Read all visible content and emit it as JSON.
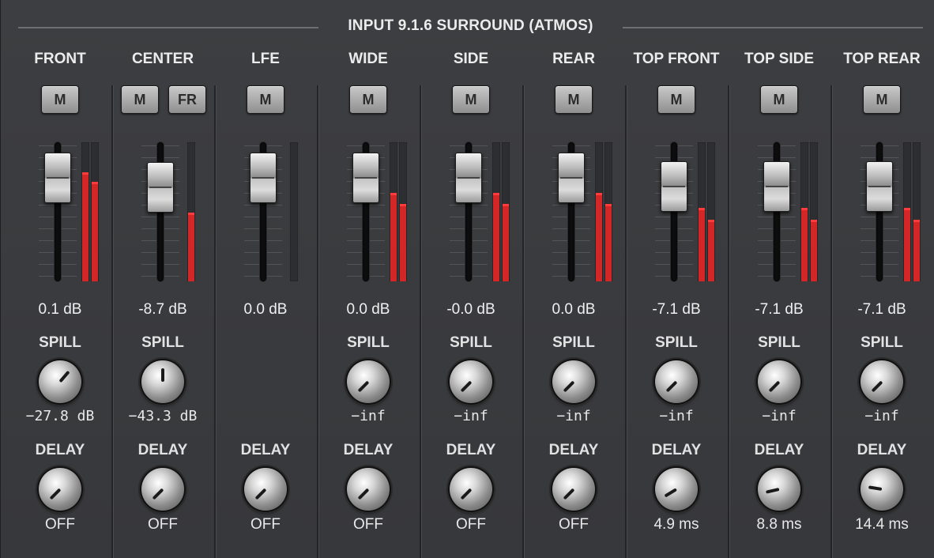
{
  "title": "INPUT 9.1.6 SURROUND (ATMOS)",
  "labels": {
    "spill": "SPILL",
    "delay": "DELAY"
  },
  "buttons": {
    "mute": "M",
    "fr": "FR"
  },
  "channels": [
    {
      "name": "FRONT",
      "gain": "0.1 dB",
      "fader": 0.88,
      "meterL": 0.78,
      "meterR": 0.71,
      "spill": "−27.8 dB",
      "spillPos": 0.65,
      "delay": "OFF",
      "delayPos": 0.0
    },
    {
      "name": "CENTER",
      "gain": "-8.7 dB",
      "fader": 0.78,
      "meterL": 0.49,
      "spill": "−43.3 dB",
      "spillPos": 0.5,
      "delay": "OFF",
      "delayPos": 0.0,
      "fr": true
    },
    {
      "name": "LFE",
      "gain": "0.0 dB",
      "fader": 0.88,
      "meterL": 0.0,
      "delay": "OFF",
      "delayPos": 0.0
    },
    {
      "name": "WIDE",
      "gain": "0.0 dB",
      "fader": 0.88,
      "meterL": 0.63,
      "meterR": 0.55,
      "spill": "−inf",
      "spillPos": 0.0,
      "delay": "OFF",
      "delayPos": 0.0
    },
    {
      "name": "SIDE",
      "gain": "-0.0 dB",
      "fader": 0.88,
      "meterL": 0.63,
      "meterR": 0.55,
      "spill": "−inf",
      "spillPos": 0.0,
      "delay": "OFF",
      "delayPos": 0.0
    },
    {
      "name": "REAR",
      "gain": "0.0 dB",
      "fader": 0.88,
      "meterL": 0.63,
      "meterR": 0.55,
      "spill": "−inf",
      "spillPos": 0.0,
      "delay": "OFF",
      "delayPos": 0.0
    },
    {
      "name": "TOP FRONT",
      "gain": "-7.1 dB",
      "fader": 0.79,
      "meterL": 0.52,
      "meterR": 0.44,
      "spill": "−inf",
      "spillPos": 0.0,
      "delay": "4.9 ms",
      "delayPos": 0.05
    },
    {
      "name": "TOP SIDE",
      "gain": "-7.1 dB",
      "fader": 0.79,
      "meterL": 0.52,
      "meterR": 0.44,
      "spill": "−inf",
      "spillPos": 0.0,
      "delay": "8.8 ms",
      "delayPos": 0.12
    },
    {
      "name": "TOP REAR",
      "gain": "-7.1 dB",
      "fader": 0.79,
      "meterL": 0.52,
      "meterR": 0.44,
      "spill": "−inf",
      "spillPos": 0.0,
      "delay": "14.4 ms",
      "delayPos": 0.2
    }
  ]
}
